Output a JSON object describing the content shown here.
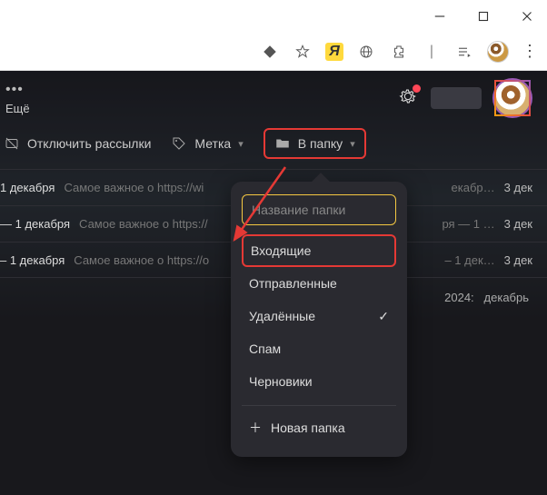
{
  "window": {
    "minimize": "—",
    "maximize": "☐",
    "close": "✕"
  },
  "header": {
    "more_dots": "•••",
    "more_label": "Ещё"
  },
  "toolbar": {
    "unsubscribe": "Отключить рассылки",
    "label": "Метка",
    "to_folder": "В папку"
  },
  "rows": [
    {
      "subject": "1 декабря",
      "preview": "Самое важное о https://wi",
      "tail": "екабр…",
      "date": "3 дек"
    },
    {
      "subject": "— 1 декабря",
      "preview": "Самое важное о https://",
      "tail": "ря — 1 …",
      "date": "3 дек"
    },
    {
      "subject": "– 1 декабря",
      "preview": "Самое важное о https://o",
      "tail": "– 1 дек…",
      "date": "3 дек"
    }
  ],
  "footer": {
    "year": "2024:",
    "month": "декабрь"
  },
  "dropdown": {
    "placeholder": "Название папки",
    "items": [
      {
        "label": "Входящие",
        "checked": false,
        "highlight": true
      },
      {
        "label": "Отправленные",
        "checked": false
      },
      {
        "label": "Удалённые",
        "checked": true
      },
      {
        "label": "Спам",
        "checked": false
      },
      {
        "label": "Черновики",
        "checked": false
      }
    ],
    "new_folder": "Новая папка"
  },
  "colors": {
    "accent_red": "#e53935",
    "accent_yellow": "#f5c842"
  }
}
